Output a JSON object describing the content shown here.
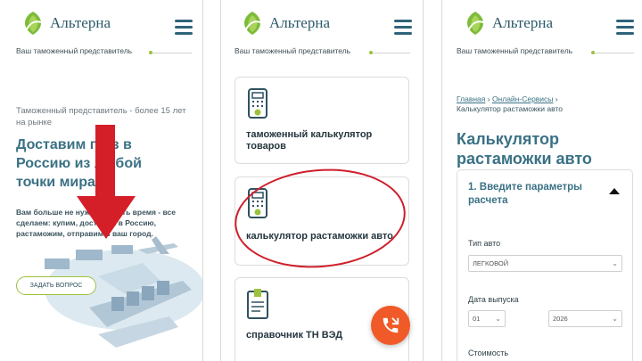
{
  "brand": {
    "name": "Альтерна",
    "tagline": "Ваш таможенный представитель"
  },
  "colors": {
    "brand_blue": "#3a7185",
    "accent_green": "#9bc23c",
    "call_orange": "#f05a28",
    "annotation_red": "#cf1f2c"
  },
  "panel1": {
    "subtitle": "Таможенный представитель - более 15 лет на рынке",
    "headline": "Доставим груз в Россию из любой точки мира",
    "body": "Вам больше не нужно тратить время - все сделаем: купим, доставим в Россию, растаможим, отправим в ваш город.",
    "cta": "ЗАДАТЬ ВОПРОС"
  },
  "panel2": {
    "cards": [
      {
        "label": "таможенный калькулятор товаров",
        "icon": "calculator-icon"
      },
      {
        "label": "калькулятор растаможки авто",
        "icon": "calculator-icon"
      },
      {
        "label": "справочник ТН ВЭД",
        "icon": "document-icon"
      }
    ],
    "call_icon": "phone-icon"
  },
  "panel3": {
    "breadcrumbs": {
      "home": "Главная",
      "services": "Онлайн-Сервисы",
      "current": "Калькулятор растаможки авто"
    },
    "title": "Калькулятор растаможки авто",
    "step": "1. Введите параметры расчета",
    "car_type_label": "Тип авто",
    "car_type_value": "ЛЕГКОВОЙ",
    "year_label": "Дата выпуска",
    "month_value": "01",
    "year_value": "2026",
    "cost_label": "Стоимость"
  }
}
